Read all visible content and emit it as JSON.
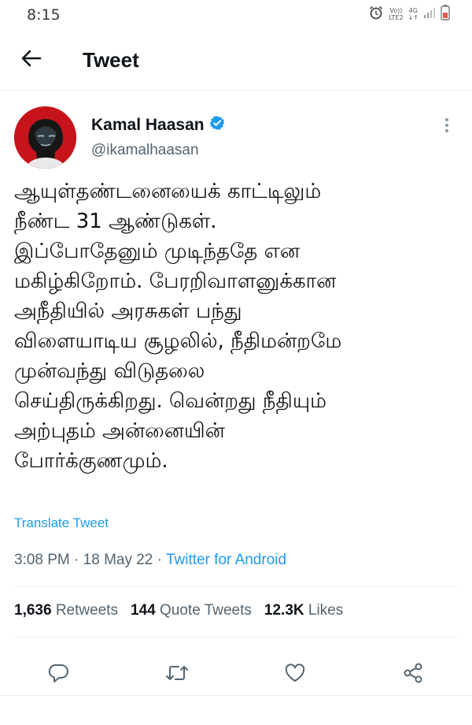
{
  "status_bar": {
    "time": "8:15",
    "network_top": "Vo))",
    "network_bottom": "LTE2",
    "gen_top": "4G",
    "gen_bottom": "↓↑"
  },
  "header": {
    "title": "Tweet"
  },
  "tweet": {
    "author": {
      "name": "Kamal Haasan",
      "handle": "@ikamalhaasan",
      "verified": true
    },
    "text_lines": [
      "ஆயுள்தண்டனையைக் காட்டிலும்",
      "நீண்ட 31 ஆண்டுகள்.",
      "இப்போதேனும் முடிந்ததே என",
      "மகிழ்கிறோம். பேரறிவாளனுக்கான",
      "அநீதியில் அரசுகள் பந்து",
      "விளையாடிய சூழலில், நீதிமன்றமே",
      "முன்வந்து விடுதலை",
      "செய்திருக்கிறது. வென்றது நீதியும்",
      "அற்புதம் அன்னையின்",
      "போர்க்குணமும்."
    ],
    "translate_label": "Translate Tweet",
    "time": "3:08 PM",
    "date": "18 May 22",
    "source": "Twitter for Android",
    "separator": "·",
    "stats": {
      "retweets_count": "1,636",
      "retweets_label": "Retweets",
      "quotes_count": "144",
      "quotes_label": "Quote Tweets",
      "likes_count": "12.3K",
      "likes_label": "Likes"
    }
  },
  "colors": {
    "accent": "#1d9bf0",
    "secondary_text": "#536471",
    "divider": "#e6ecf0"
  },
  "icons": [
    "back-arrow-icon",
    "verified-badge-icon",
    "more-vertical-icon",
    "reply-icon",
    "retweet-icon",
    "like-icon",
    "share-icon"
  ]
}
